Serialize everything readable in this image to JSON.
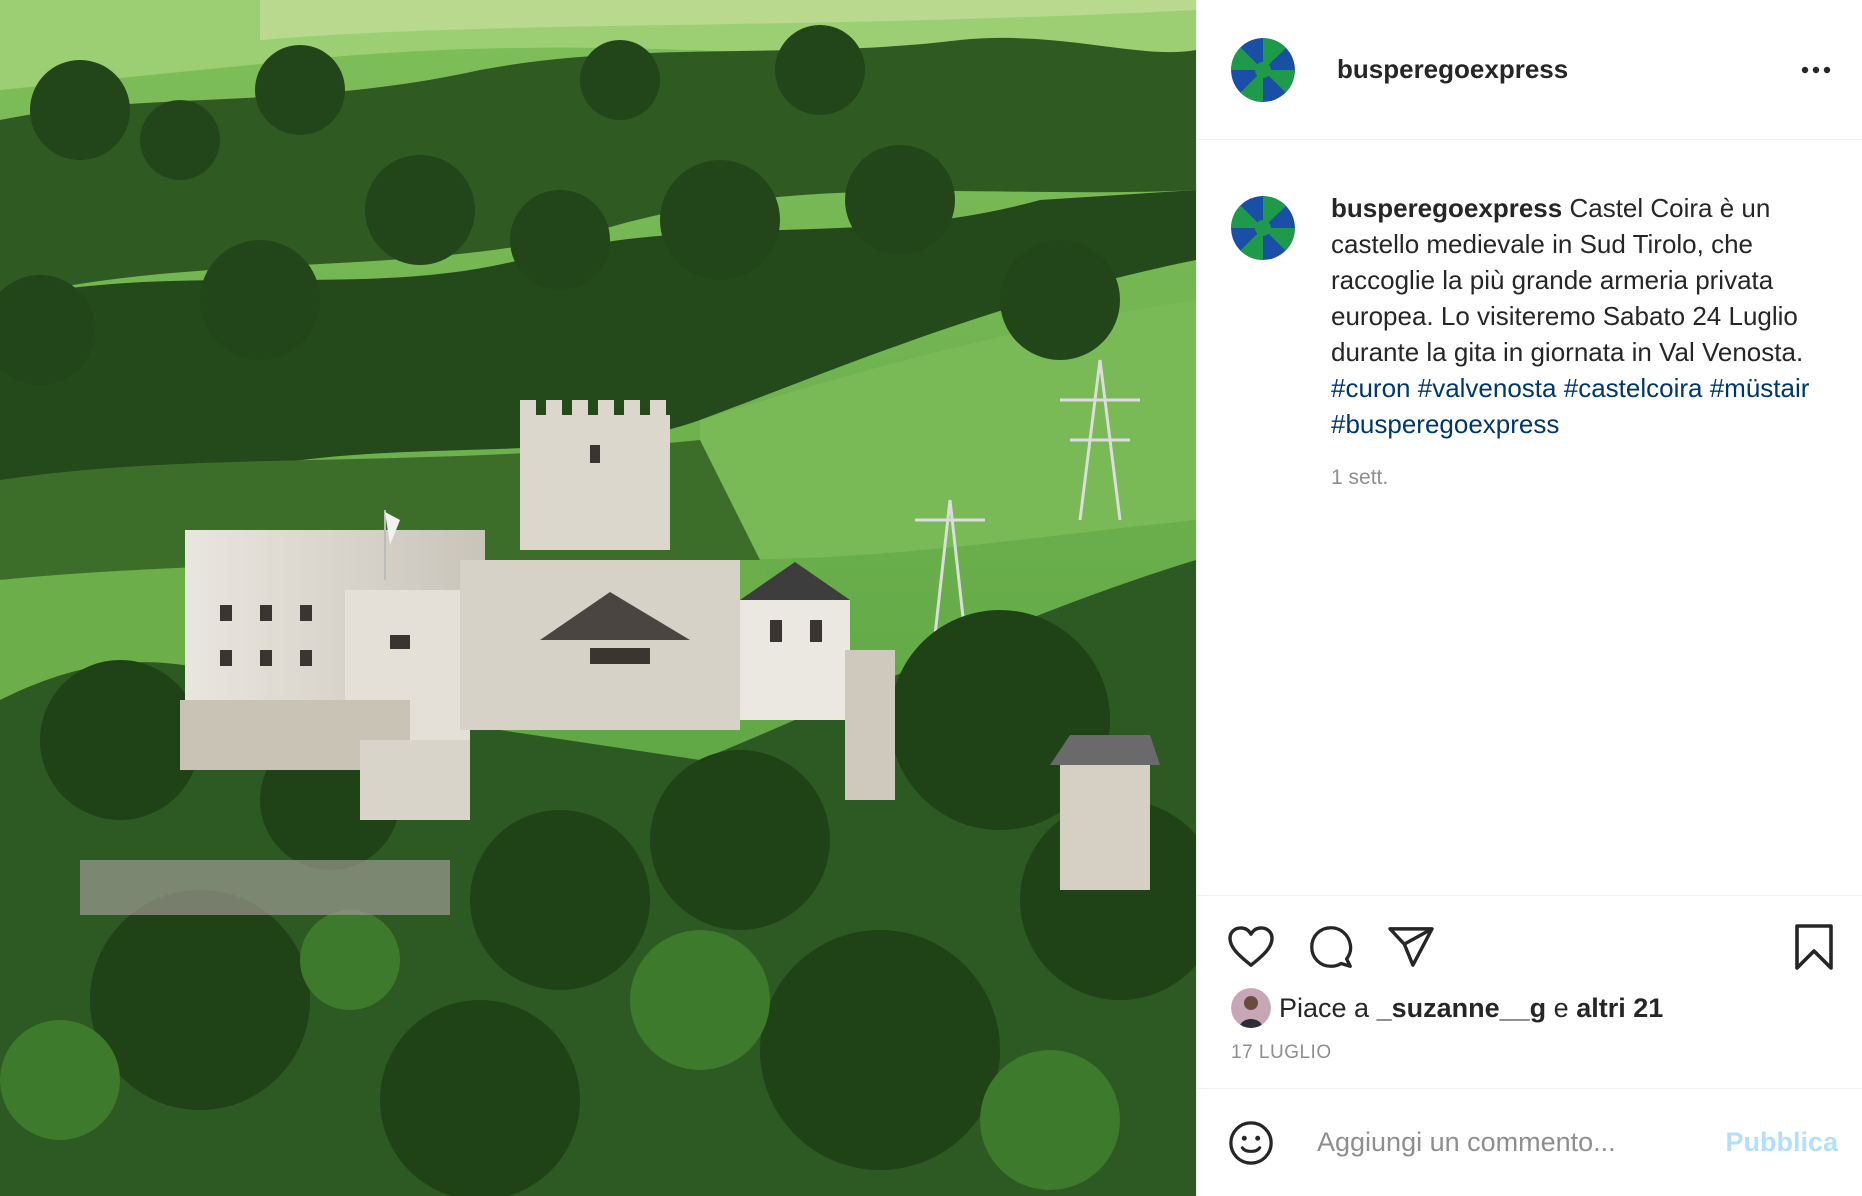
{
  "header": {
    "username": "busperegoexpress"
  },
  "caption": {
    "username": "busperegoexpress",
    "text": "Castel Coira è un castello medievale in Sud Tirolo, che raccoglie la più grande armeria privata europea. Lo visiteremo Sabato 24 Luglio durante la gita in giornata in Val Venosta.",
    "hashtags": [
      "#curon",
      "#valvenosta",
      "#castelcoira",
      "#müstair",
      "#busperegoexpress"
    ],
    "time": "1 sett."
  },
  "likes": {
    "prefix": "Piace a",
    "user": "_suzanne__g",
    "joiner": "e",
    "others": "altri 21"
  },
  "date": "17 LUGLIO",
  "comment_box": {
    "placeholder": "Aggiungi un commento...",
    "publish_label": "Pubblica"
  },
  "icons": {
    "more": "more-options-icon",
    "like": "heart-icon",
    "comment": "comment-bubble-icon",
    "share": "paper-plane-icon",
    "save": "bookmark-icon",
    "emoji": "smiley-icon"
  },
  "colors": {
    "hashtag": "#00376b",
    "publish_disabled": "#b2dffc",
    "secondary_text": "#8e8e8e",
    "avatar_green": "#1f9a4a",
    "avatar_blue": "#1a4fa8"
  }
}
